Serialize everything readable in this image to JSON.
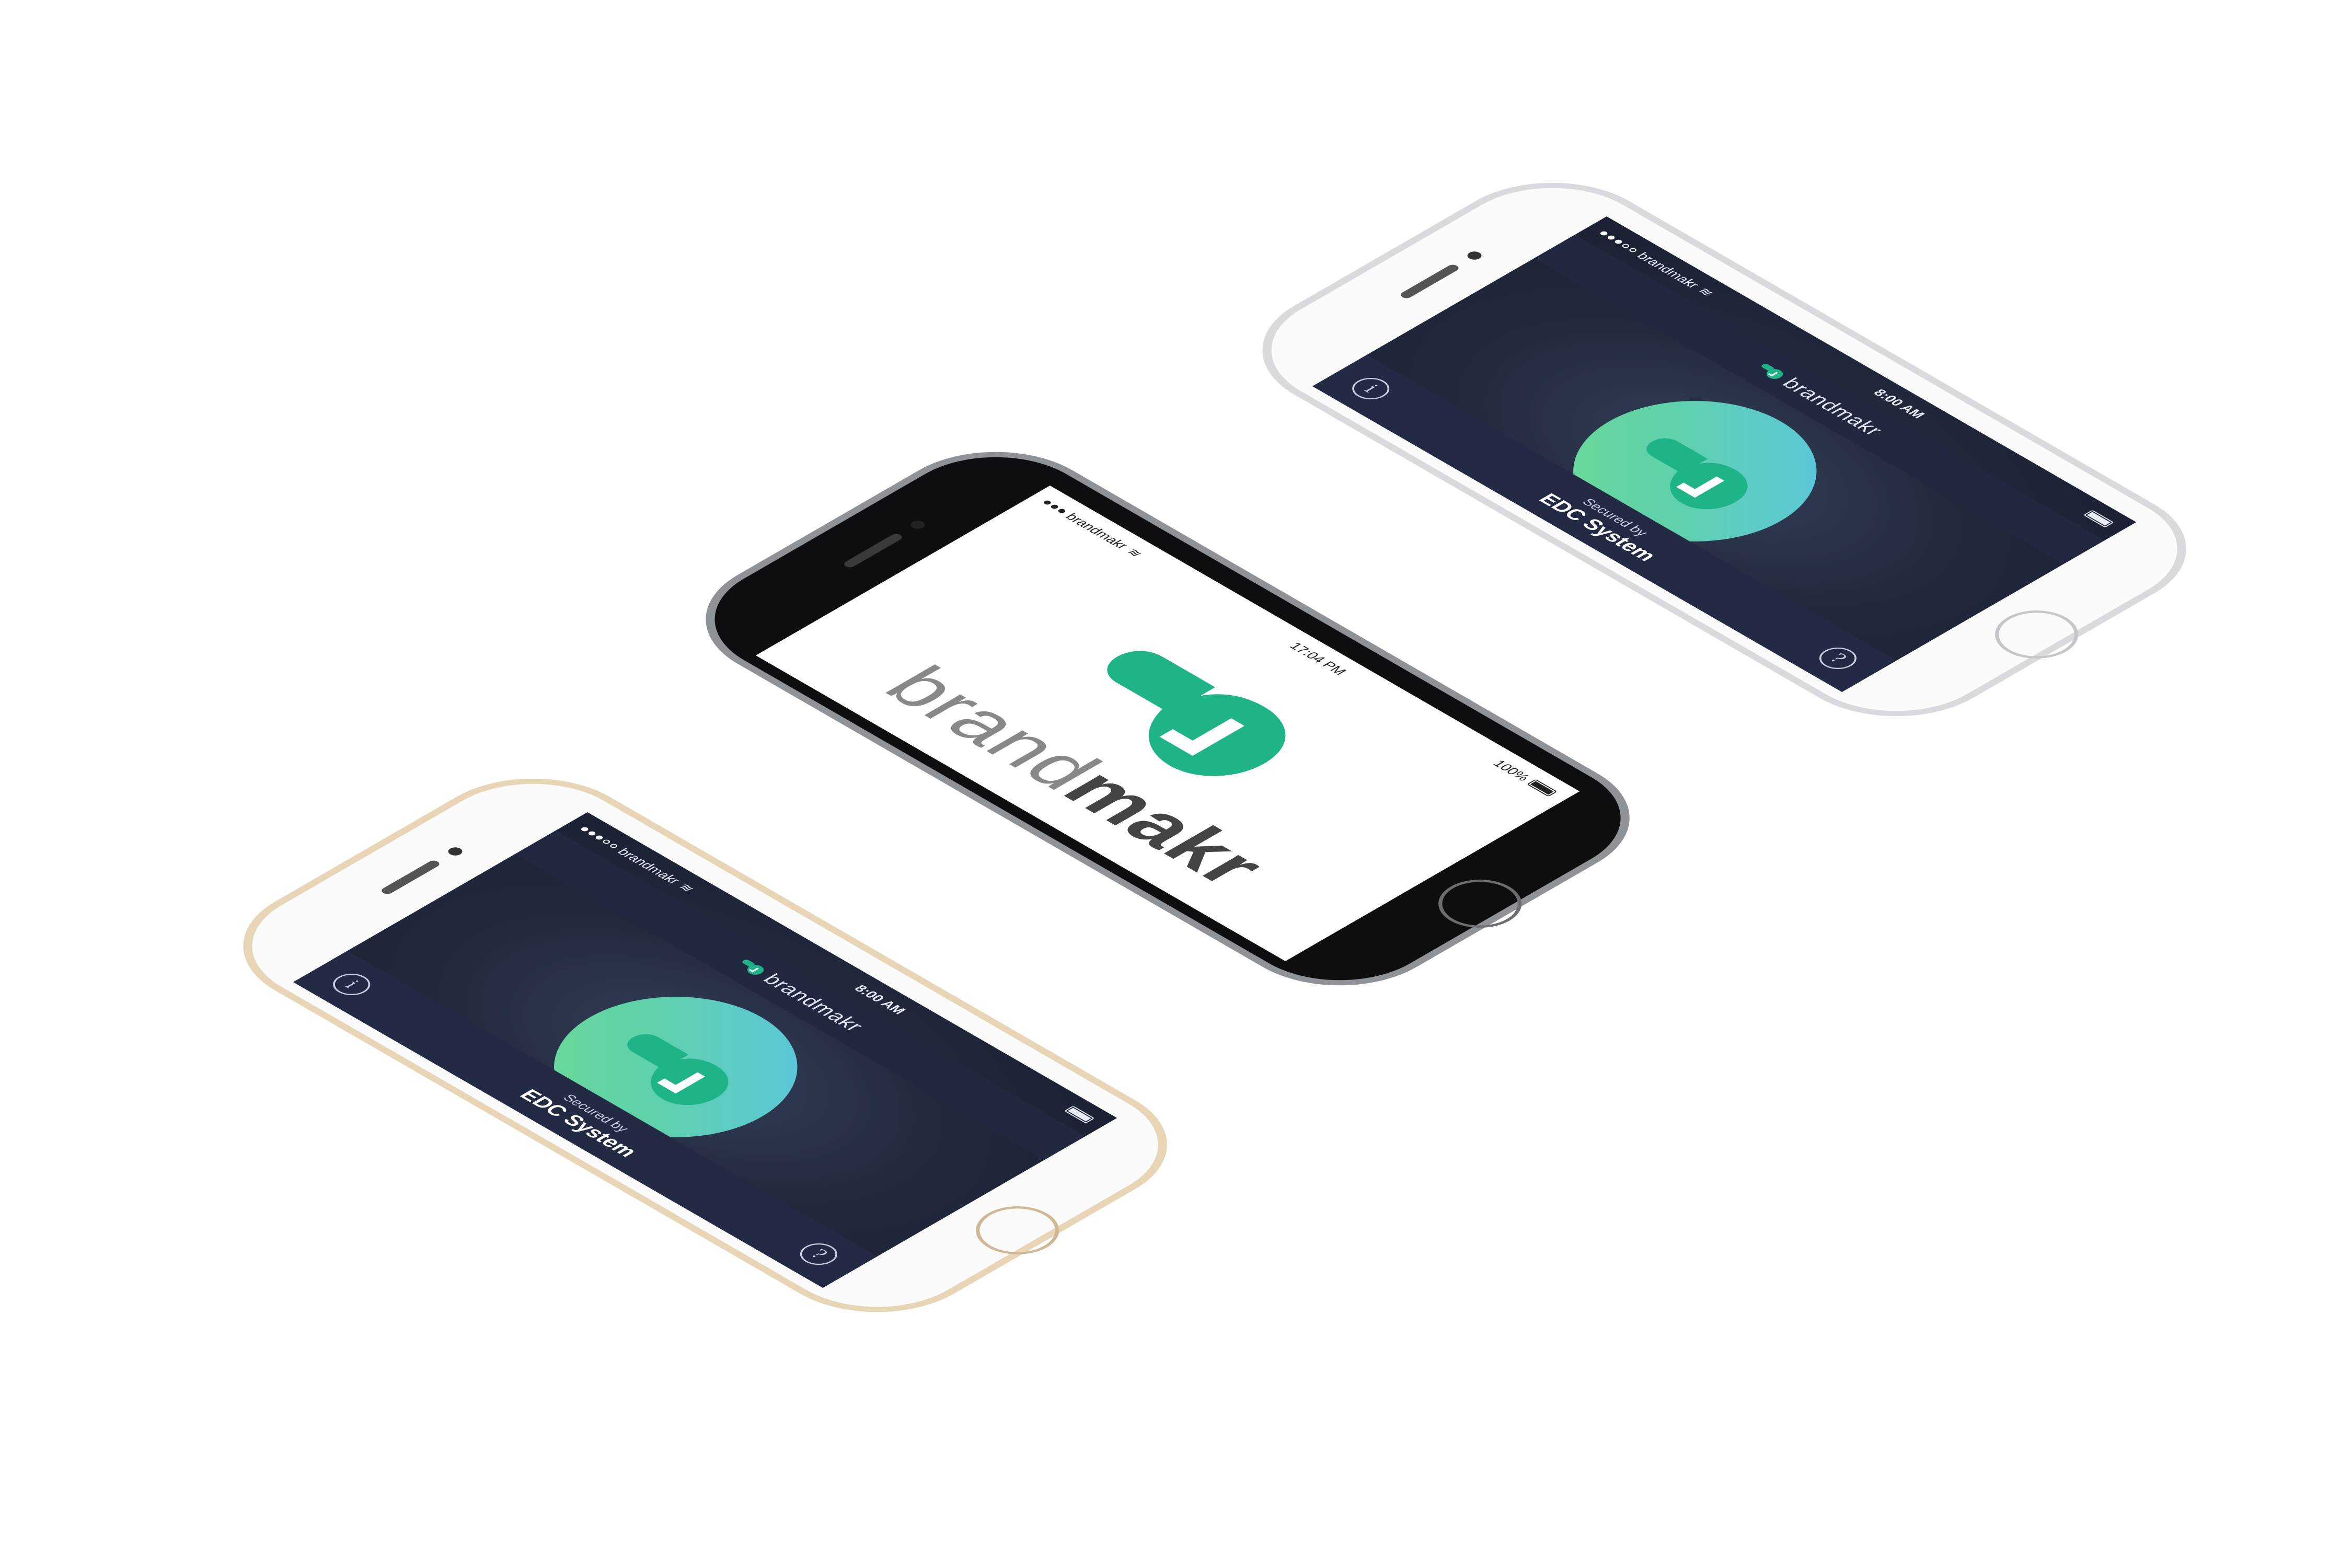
{
  "colors": {
    "accent_green": "#1fb388",
    "logo_gradient_start": "#5ac3e6",
    "logo_gradient_end": "#6edb95",
    "dark_screen_bg": "#222a3d",
    "gold_frame": "#e7d5b5",
    "silver_frame": "#d8dadd",
    "space_gray_frame": "#2c2c2e"
  },
  "phones": {
    "left": {
      "frame": "gold",
      "statusbar": {
        "carrier": "brandmakr",
        "time": "8:00 AM"
      },
      "topbar": {
        "brand": "brandmakr"
      },
      "bottombar": {
        "info_icon": "i",
        "secured_line1": "Secured by",
        "secured_line2": "EDC System",
        "help_icon": "?"
      }
    },
    "center": {
      "frame": "space-gray",
      "statusbar": {
        "carrier": "brandmakr",
        "time": "17:04 PM",
        "battery_text": "100%"
      },
      "wordmark_light": "brand",
      "wordmark_bold": "makr"
    },
    "right": {
      "frame": "silver",
      "statusbar": {
        "carrier": "brandmakr",
        "time": "8:00 AM"
      },
      "topbar": {
        "brand": "brandmakr"
      },
      "bottombar": {
        "info_icon": "i",
        "secured_line1": "Secured by",
        "secured_line2": "EDC System",
        "help_icon": "?"
      }
    }
  }
}
